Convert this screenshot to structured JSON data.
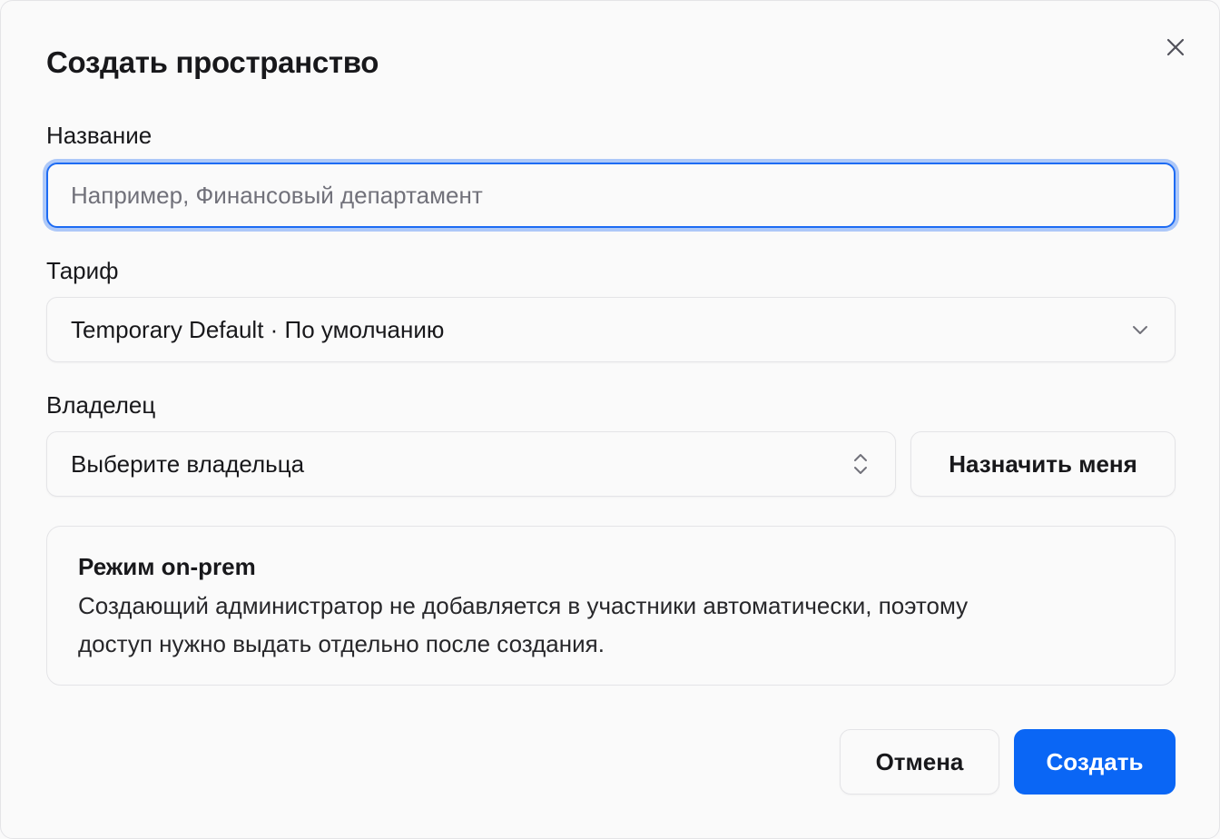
{
  "dialog": {
    "title": "Создать пространство",
    "close_icon": "close-icon"
  },
  "name_field": {
    "label": "Название",
    "placeholder": "Например, Финансовый департамент",
    "value": ""
  },
  "tariff_field": {
    "label": "Тариф",
    "selected": "Temporary Default · По умолчанию",
    "icon": "chevron-down-icon"
  },
  "owner_field": {
    "label": "Владелец",
    "selected": "Выберите владельца",
    "icon": "chevron-up-down-icon",
    "assign_me_label": "Назначить меня"
  },
  "note": {
    "title": "Режим on-prem",
    "text_line1": "Создающий администратор не добавляется в участники автоматически, поэтому",
    "text_line2": "доступ нужно выдать отдельно после создания."
  },
  "footer": {
    "cancel_label": "Отмена",
    "create_label": "Создать"
  },
  "colors": {
    "accent": "#0a66f5",
    "focus_ring": "#1d6bf3",
    "border": "#e4e4e7",
    "background": "#fafafa"
  }
}
